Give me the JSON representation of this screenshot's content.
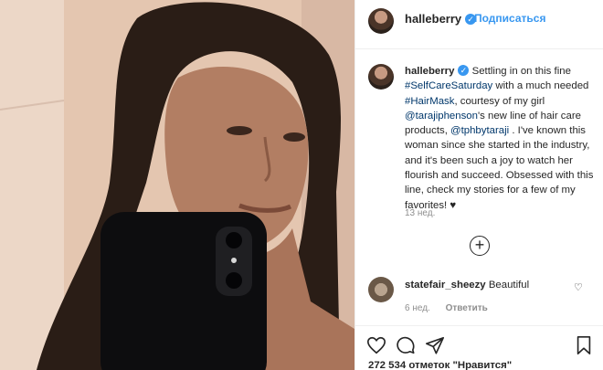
{
  "header": {
    "username": "halleberry",
    "verified_symbol": "✓",
    "follow_label": "Подписаться"
  },
  "caption": {
    "username": "halleberry",
    "verified_symbol": "✓",
    "text_1": "Settling in on this fine ",
    "tag_selfcare": "#SelfCareSaturday",
    "text_2": " with a much needed ",
    "tag_hairmask": "#HairMask",
    "text_3": ", courtesy of my girl ",
    "mention_taraji": "@tarajiphenson",
    "text_4": "'s new line of hair care products, ",
    "mention_tph": "@tphbytaraji",
    "text_5": " . I've known this woman since she started in the industry, and it's been such a joy to watch her flourish and succeed. Obsessed with this line, check my stories for a few of my favorites! ♥",
    "time": "13 нед."
  },
  "add_comment_symbol": "+",
  "comment": {
    "username": "statefair_sheezy",
    "text": "Beautiful",
    "time": "6 нед.",
    "reply_label": "Ответить",
    "heart_symbol": "♡"
  },
  "likes": "272 534 отметок \"Нравится\"",
  "icons": [
    "heart-icon",
    "comment-icon",
    "share-icon",
    "bookmark-icon",
    "plus-circle-icon",
    "verified-badge-icon"
  ],
  "colors": {
    "accent": "#3897f0",
    "link": "#00376b",
    "muted": "#8e8e8e",
    "text": "#262626",
    "divider": "#efefef"
  }
}
